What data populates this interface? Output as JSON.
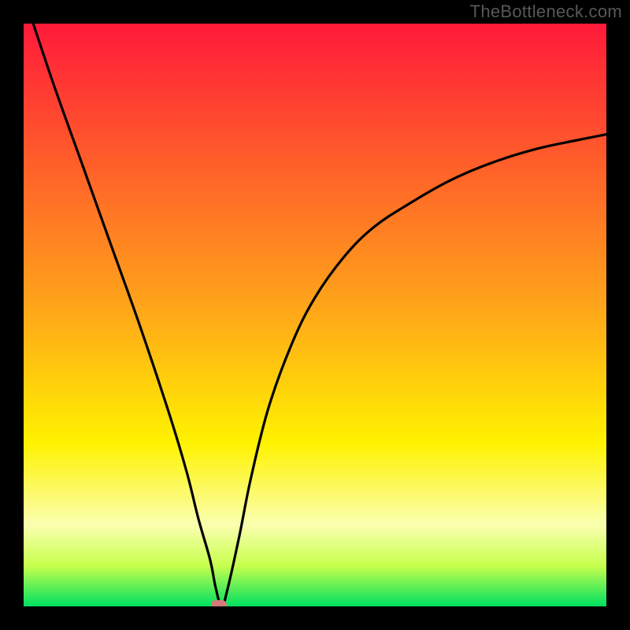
{
  "watermark": "TheBottleneck.com",
  "chart_data": {
    "type": "line",
    "title": "",
    "xlabel": "",
    "ylabel": "",
    "xlim": [
      0,
      100
    ],
    "ylim": [
      0,
      100
    ],
    "grid": false,
    "legend": false,
    "background_gradient": {
      "stops": [
        {
          "offset": 0,
          "color": "#ff1a3a"
        },
        {
          "offset": 48,
          "color": "#ffa31a"
        },
        {
          "offset": 72,
          "color": "#fff200"
        },
        {
          "offset": 86,
          "color": "#faffb0"
        },
        {
          "offset": 93,
          "color": "#c8ff4d"
        },
        {
          "offset": 100,
          "color": "#00e060"
        }
      ]
    },
    "series": [
      {
        "name": "bottleneck_curve",
        "color": "#000000",
        "x": [
          0,
          5,
          10,
          15,
          20,
          25,
          28,
          30,
          32,
          33,
          34,
          35,
          37,
          39,
          42,
          46,
          50,
          55,
          60,
          66,
          73,
          80,
          88,
          95,
          100
        ],
        "y": [
          105,
          90,
          76,
          62,
          48,
          33,
          23,
          15,
          8,
          3,
          0,
          3,
          12,
          22,
          34,
          45,
          53,
          60,
          65,
          69,
          73,
          76,
          78.5,
          80,
          81
        ]
      }
    ],
    "marker": {
      "name": "selected_point",
      "shape": "rounded_rect",
      "cx": 33.5,
      "cy": 0,
      "color": "#d47a7a"
    }
  }
}
